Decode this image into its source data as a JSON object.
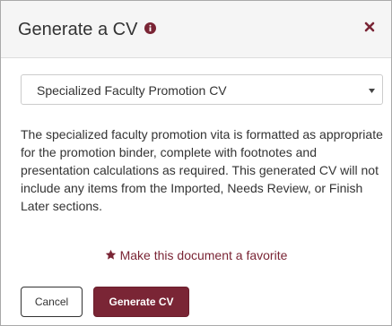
{
  "dialog": {
    "title": "Generate a CV",
    "close_label": "×"
  },
  "cv_select": {
    "selected": "Specialized Faculty Promotion CV"
  },
  "description": "The specialized faculty promotion vita is formatted as appropriate for the promotion binder, complete with footnotes and presentation calculations as required. This generated CV will not include any items from the Imported, Needs Review, or Finish Later sections.",
  "favorite": {
    "label": "Make this document a favorite"
  },
  "buttons": {
    "cancel": "Cancel",
    "generate": "Generate CV"
  },
  "colors": {
    "accent": "#7a2535",
    "header_bg": "#f5f5f5",
    "text": "#333333"
  },
  "icons": {
    "info": "info-circle-icon",
    "close": "close-icon",
    "caret": "caret-down-icon",
    "star": "star-icon"
  }
}
